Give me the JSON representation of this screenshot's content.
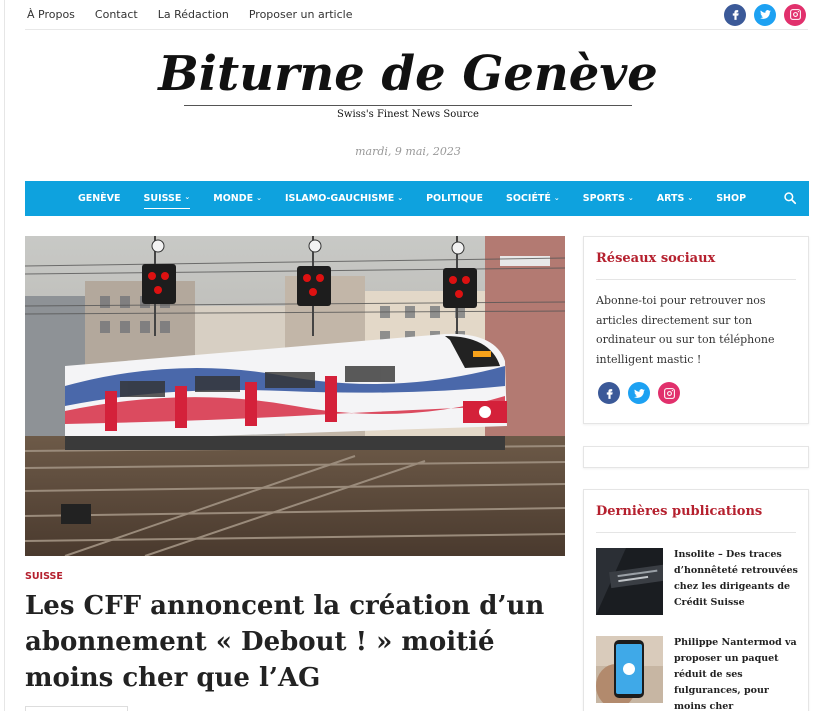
{
  "topbar": {
    "links": [
      "À Propos",
      "Contact",
      "La Rédaction",
      "Proposer un article"
    ],
    "social": [
      "facebook-icon",
      "twitter-icon",
      "instagram-icon"
    ]
  },
  "site": {
    "title": "Biturne de Genève",
    "tagline": "Swiss's Finest News Source",
    "date": "mardi, 9 mai, 2023"
  },
  "nav": {
    "items": [
      {
        "label": "GENÈVE",
        "dropdown": false
      },
      {
        "label": "SUISSE",
        "dropdown": true,
        "active": true
      },
      {
        "label": "MONDE",
        "dropdown": true
      },
      {
        "label": "ISLAMO-GAUCHISME",
        "dropdown": true
      },
      {
        "label": "POLITIQUE",
        "dropdown": false
      },
      {
        "label": "SOCIÉTÉ",
        "dropdown": true
      },
      {
        "label": "SPORTS",
        "dropdown": true
      },
      {
        "label": "ARTS",
        "dropdown": true
      },
      {
        "label": "SHOP",
        "dropdown": false
      }
    ]
  },
  "article": {
    "category": "SUISSE",
    "headline": "Les CFF annoncent la création d’un abonnement « Debout ! » moitié moins cher que l’AG"
  },
  "sidebar": {
    "social_widget": {
      "title": "Réseaux sociaux",
      "text": "Abonne-toi pour retrouver nos articles directement sur ton ordinateur ou sur ton téléphone intelligent mastic !"
    },
    "latest": {
      "title": "Dernières publications",
      "posts": [
        {
          "title": "Insolite – Des traces d’honnêteté retrouvées chez les dirigeants de Crédit Suisse"
        },
        {
          "title": "Philippe Nantermod va proposer un paquet réduit de ses fulgurances, pour moins cher"
        }
      ]
    }
  },
  "colors": {
    "nav_bg": "#0ea2de",
    "accent_red": "#b5202e",
    "facebook": "#3b5998",
    "twitter": "#1da1f2",
    "instagram": "#e1306c"
  }
}
